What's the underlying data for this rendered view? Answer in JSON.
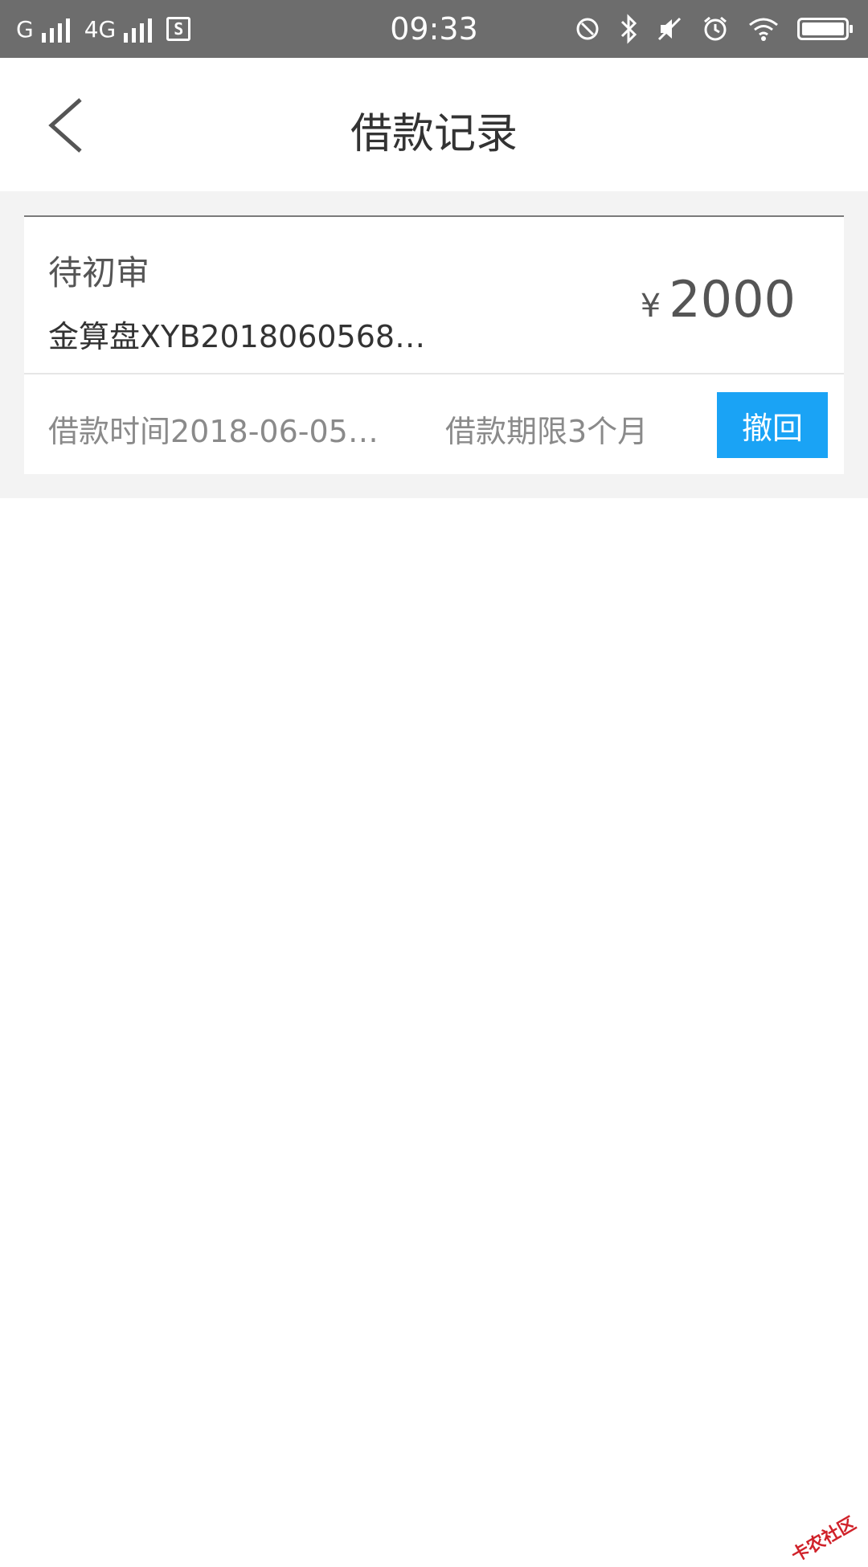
{
  "status_bar": {
    "network_1": "G",
    "network_2": "4G",
    "sim_badge": "S",
    "time": "09:33",
    "icons": [
      "rotation-lock-icon",
      "bluetooth-icon",
      "mute-icon",
      "alarm-icon",
      "wifi-icon",
      "battery-icon"
    ]
  },
  "header": {
    "title": "借款记录",
    "back_icon": "chevron-left-icon"
  },
  "loan_record": {
    "status": "待初审",
    "product": "金算盘XYB2018060568…",
    "currency_symbol": "¥",
    "amount": "2000",
    "borrow_time": "借款时间2018-06-05…",
    "borrow_term": "借款期限3个月",
    "withdraw_label": "撤回"
  },
  "watermark": "卡农社区",
  "colors": {
    "status_bar_bg": "#6d6d6d",
    "accent_button": "#1aa3f5",
    "page_bg": "#f3f3f3"
  }
}
